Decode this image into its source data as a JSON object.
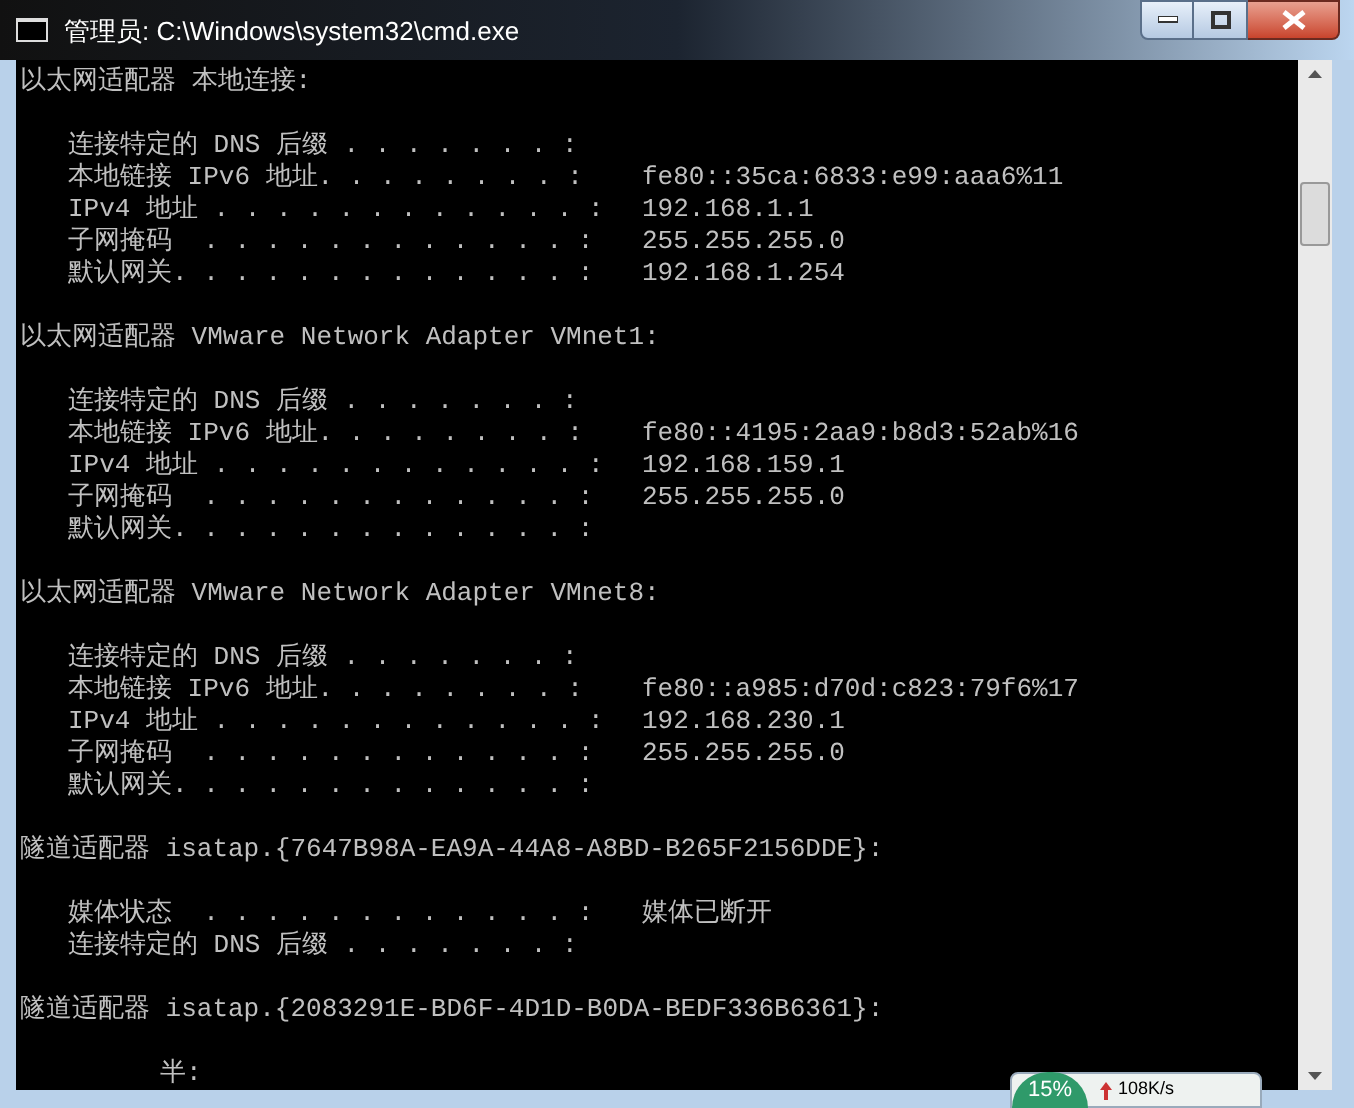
{
  "window": {
    "title": "管理员: C:\\Windows\\system32\\cmd.exe"
  },
  "sections": [
    {
      "header": "以太网适配器 本地连接:",
      "entries": [
        {
          "kind": "field",
          "label": "连接特定的 DNS 后缀 . . . . . . . :"
        },
        {
          "kind": "field",
          "label": "本地链接 IPv6 地址. . . . . . . . :",
          "value": "fe80::35ca:6833:e99:aaa6%11"
        },
        {
          "kind": "field",
          "label": "IPv4 地址 . . . . . . . . . . . . :",
          "value": "192.168.1.1"
        },
        {
          "kind": "field",
          "label": "子网掩码  . . . . . . . . . . . . :",
          "value": "255.255.255.0"
        },
        {
          "kind": "field",
          "label": "默认网关. . . . . . . . . . . . . :",
          "value": "192.168.1.254"
        }
      ]
    },
    {
      "header": "以太网适配器 VMware Network Adapter VMnet1:",
      "entries": [
        {
          "kind": "field",
          "label": "连接特定的 DNS 后缀 . . . . . . . :"
        },
        {
          "kind": "field",
          "label": "本地链接 IPv6 地址. . . . . . . . :",
          "value": "fe80::4195:2aa9:b8d3:52ab%16"
        },
        {
          "kind": "field",
          "label": "IPv4 地址 . . . . . . . . . . . . :",
          "value": "192.168.159.1"
        },
        {
          "kind": "field",
          "label": "子网掩码  . . . . . . . . . . . . :",
          "value": "255.255.255.0"
        },
        {
          "kind": "field",
          "label": "默认网关. . . . . . . . . . . . . :"
        }
      ]
    },
    {
      "header": "以太网适配器 VMware Network Adapter VMnet8:",
      "entries": [
        {
          "kind": "field",
          "label": "连接特定的 DNS 后缀 . . . . . . . :"
        },
        {
          "kind": "field",
          "label": "本地链接 IPv6 地址. . . . . . . . :",
          "value": "fe80::a985:d70d:c823:79f6%17"
        },
        {
          "kind": "field",
          "label": "IPv4 地址 . . . . . . . . . . . . :",
          "value": "192.168.230.1"
        },
        {
          "kind": "field",
          "label": "子网掩码  . . . . . . . . . . . . :",
          "value": "255.255.255.0"
        },
        {
          "kind": "field",
          "label": "默认网关. . . . . . . . . . . . . :"
        }
      ]
    },
    {
      "header": "隧道适配器 isatap.{7647B98A-EA9A-44A8-A8BD-B265F2156DDE}:",
      "entries": [
        {
          "kind": "field",
          "label": "媒体状态  . . . . . . . . . . . . :",
          "value": "媒体已断开"
        },
        {
          "kind": "field",
          "label": "连接特定的 DNS 后缀 . . . . . . . :"
        }
      ]
    },
    {
      "header": "隧道适配器 isatap.{2083291E-BD6F-4D1D-B0DA-BEDF336B6361}:",
      "entries": [
        {
          "kind": "fragment",
          "label": "半:"
        }
      ]
    }
  ],
  "speed_widget": {
    "percent": "15%",
    "speed": "108K/s"
  }
}
